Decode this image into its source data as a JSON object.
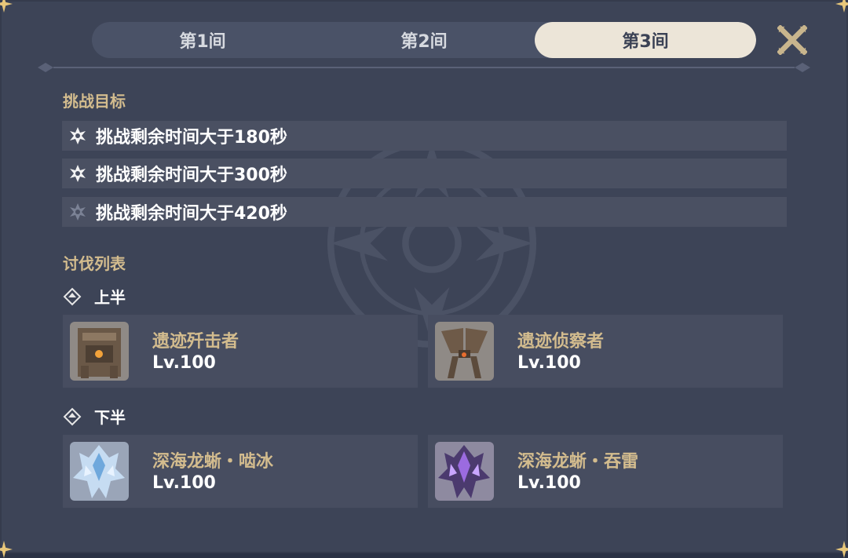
{
  "tabs": [
    {
      "label": "第1间",
      "active": false
    },
    {
      "label": "第2间",
      "active": false
    },
    {
      "label": "第3间",
      "active": true
    }
  ],
  "close_icon": "close-x-icon",
  "goals_section": {
    "title": "挑战目标",
    "items": [
      {
        "text": "挑战剩余时间大于180秒",
        "achieved": true
      },
      {
        "text": "挑战剩余时间大于300秒",
        "achieved": true
      },
      {
        "text": "挑战剩余时间大于420秒",
        "achieved": false
      }
    ]
  },
  "enemies_section": {
    "title": "讨伐列表",
    "first_half": {
      "label": "上半",
      "enemies": [
        {
          "name": "遗迹歼击者",
          "level": "Lv.100",
          "portrait": "ruin-destroyer-portrait"
        },
        {
          "name": "遗迹侦察者",
          "level": "Lv.100",
          "portrait": "ruin-scout-portrait"
        }
      ]
    },
    "second_half": {
      "label": "下半",
      "enemies": [
        {
          "name": "深海龙蜥・啮冰",
          "level": "Lv.100",
          "portrait": "cryo-bathysmal-vishap-portrait"
        },
        {
          "name": "深海龙蜥・吞雷",
          "level": "Lv.100",
          "portrait": "electro-bathysmal-vishap-portrait"
        }
      ]
    }
  },
  "colors": {
    "panel": "#3d4457",
    "active_tab": "#ece5d8",
    "gold_text": "#d3bc8e",
    "row_bg": "#4a5062"
  }
}
